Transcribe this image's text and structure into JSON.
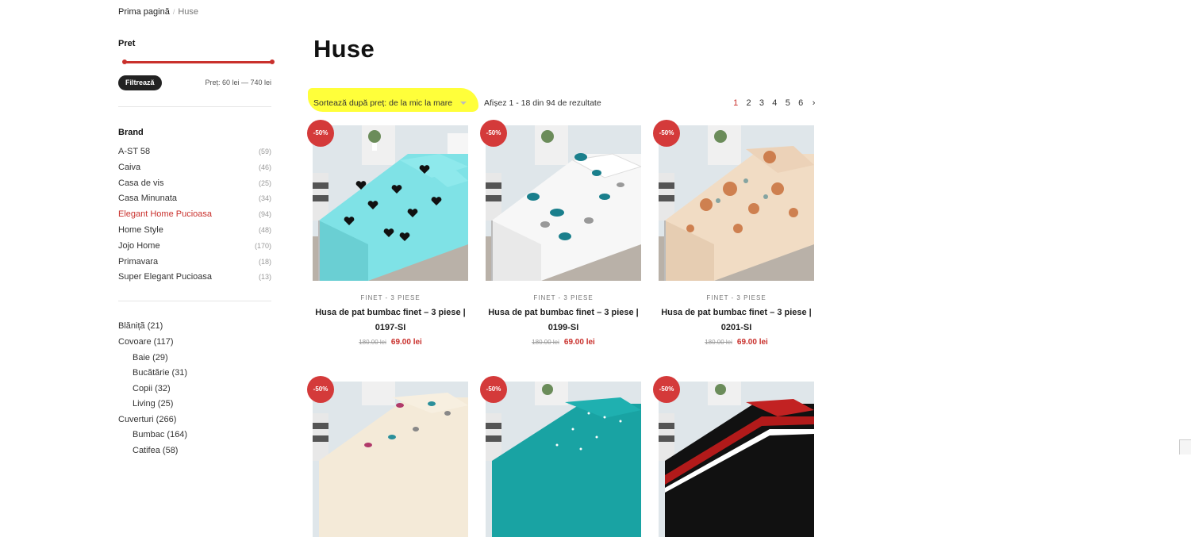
{
  "breadcrumb": {
    "home": "Prima pagină",
    "current": "Huse"
  },
  "filter_price": {
    "heading": "Pret",
    "button": "Filtrează",
    "range": "Preț: 60 lei — 740 lei"
  },
  "brand": {
    "heading": "Brand",
    "items": [
      {
        "name": "A-ST 58",
        "count": "(59)"
      },
      {
        "name": "Caiva",
        "count": "(46)"
      },
      {
        "name": "Casa de vis",
        "count": "(25)"
      },
      {
        "name": "Casa Minunata",
        "count": "(34)"
      },
      {
        "name": "Elegant Home Pucioasa",
        "count": "(94)",
        "active": true
      },
      {
        "name": "Home Style",
        "count": "(48)"
      },
      {
        "name": "Jojo Home",
        "count": "(170)"
      },
      {
        "name": "Primavara",
        "count": "(18)"
      },
      {
        "name": "Super Elegant Pucioasa",
        "count": "(13)"
      }
    ]
  },
  "categories": [
    {
      "label": "Blănițã (21)",
      "sub": false
    },
    {
      "label": "Covoare (117)",
      "sub": false
    },
    {
      "label": "Baie (29)",
      "sub": true
    },
    {
      "label": "Bucătărie (31)",
      "sub": true
    },
    {
      "label": "Copii (32)",
      "sub": true
    },
    {
      "label": "Living (25)",
      "sub": true
    },
    {
      "label": "Cuverturi (266)",
      "sub": false
    },
    {
      "label": "Bumbac (164)",
      "sub": true
    },
    {
      "label": "Catifea (58)",
      "sub": true
    }
  ],
  "page_title": "Huse",
  "sort": {
    "selected": "Sortează după preț: de la mic la mare"
  },
  "results_text": "Afișez 1 - 18 din 94 de rezultate",
  "pagination": {
    "pages": [
      "1",
      "2",
      "3",
      "4",
      "5",
      "6"
    ],
    "current": "1",
    "next": "›"
  },
  "colors": {
    "accent": "#c9302c",
    "badge": "#d43a3a",
    "highlight": "#ffff3a"
  },
  "products": [
    {
      "badge": "-50%",
      "category": "FINET - 3 PIESE",
      "name_line1": "Husa de pat bumbac finet – 3 piese |",
      "name_line2": "0197-SI",
      "old_price": "180.00 lei",
      "price": "69.00 lei",
      "pattern": "black-hearts-on-aqua"
    },
    {
      "badge": "-50%",
      "category": "FINET - 3 PIESE",
      "name_line1": "Husa de pat bumbac finet – 3 piese |",
      "name_line2": "0199-SI",
      "old_price": "180.00 lei",
      "price": "69.00 lei",
      "pattern": "teal-butterflies-on-white"
    },
    {
      "badge": "-50%",
      "category": "FINET - 3 PIESE",
      "name_line1": "Husa de pat bumbac finet – 3 piese |",
      "name_line2": "0201-SI",
      "old_price": "180.00 lei",
      "price": "69.00 lei",
      "pattern": "orange-flowers-on-beige"
    },
    {
      "badge": "-50%",
      "pattern": "butterflies-on-cream"
    },
    {
      "badge": "-50%",
      "pattern": "white-dots-on-teal"
    },
    {
      "badge": "-50%",
      "pattern": "black-red-white-stripes"
    }
  ]
}
